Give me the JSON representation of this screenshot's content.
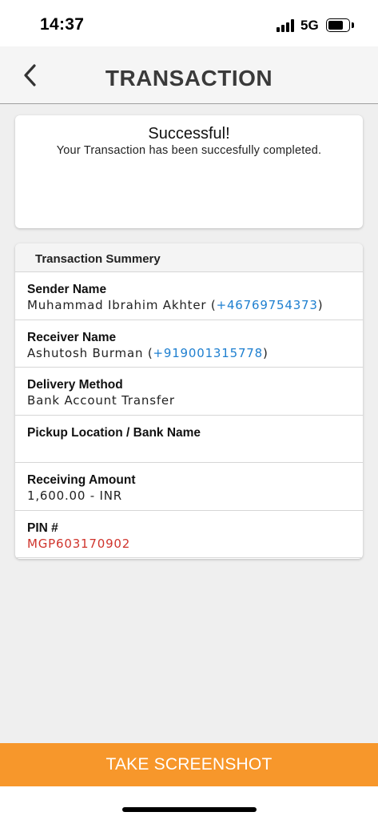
{
  "status_bar": {
    "time": "14:37",
    "network": "5G"
  },
  "header": {
    "title": "TRANSACTION",
    "back_icon": "chevron-left-icon"
  },
  "result": {
    "title": "Successful!",
    "message": "Your Transaction has been succesfully completed."
  },
  "summary": {
    "heading": "Transaction Summery",
    "sender": {
      "label": "Sender Name",
      "name": "Muhammad Ibrahim Akhter",
      "phone": "+46769754373"
    },
    "receiver": {
      "label": "Receiver Name",
      "name": "Ashutosh Burman",
      "phone": "+919001315778"
    },
    "delivery": {
      "label": "Delivery Method",
      "value": "Bank Account Transfer"
    },
    "pickup": {
      "label": "Pickup Location / Bank Name",
      "value": ""
    },
    "amount": {
      "label": "Receiving Amount",
      "value": "1,600.00 - INR"
    },
    "pin": {
      "label": "PIN #",
      "value": "MGP603170902"
    }
  },
  "footer": {
    "button_label": "TAKE SCREENSHOT"
  },
  "colors": {
    "accent": "#f7972b",
    "phone_link": "#1e7fd0",
    "pin": "#d0342c"
  }
}
